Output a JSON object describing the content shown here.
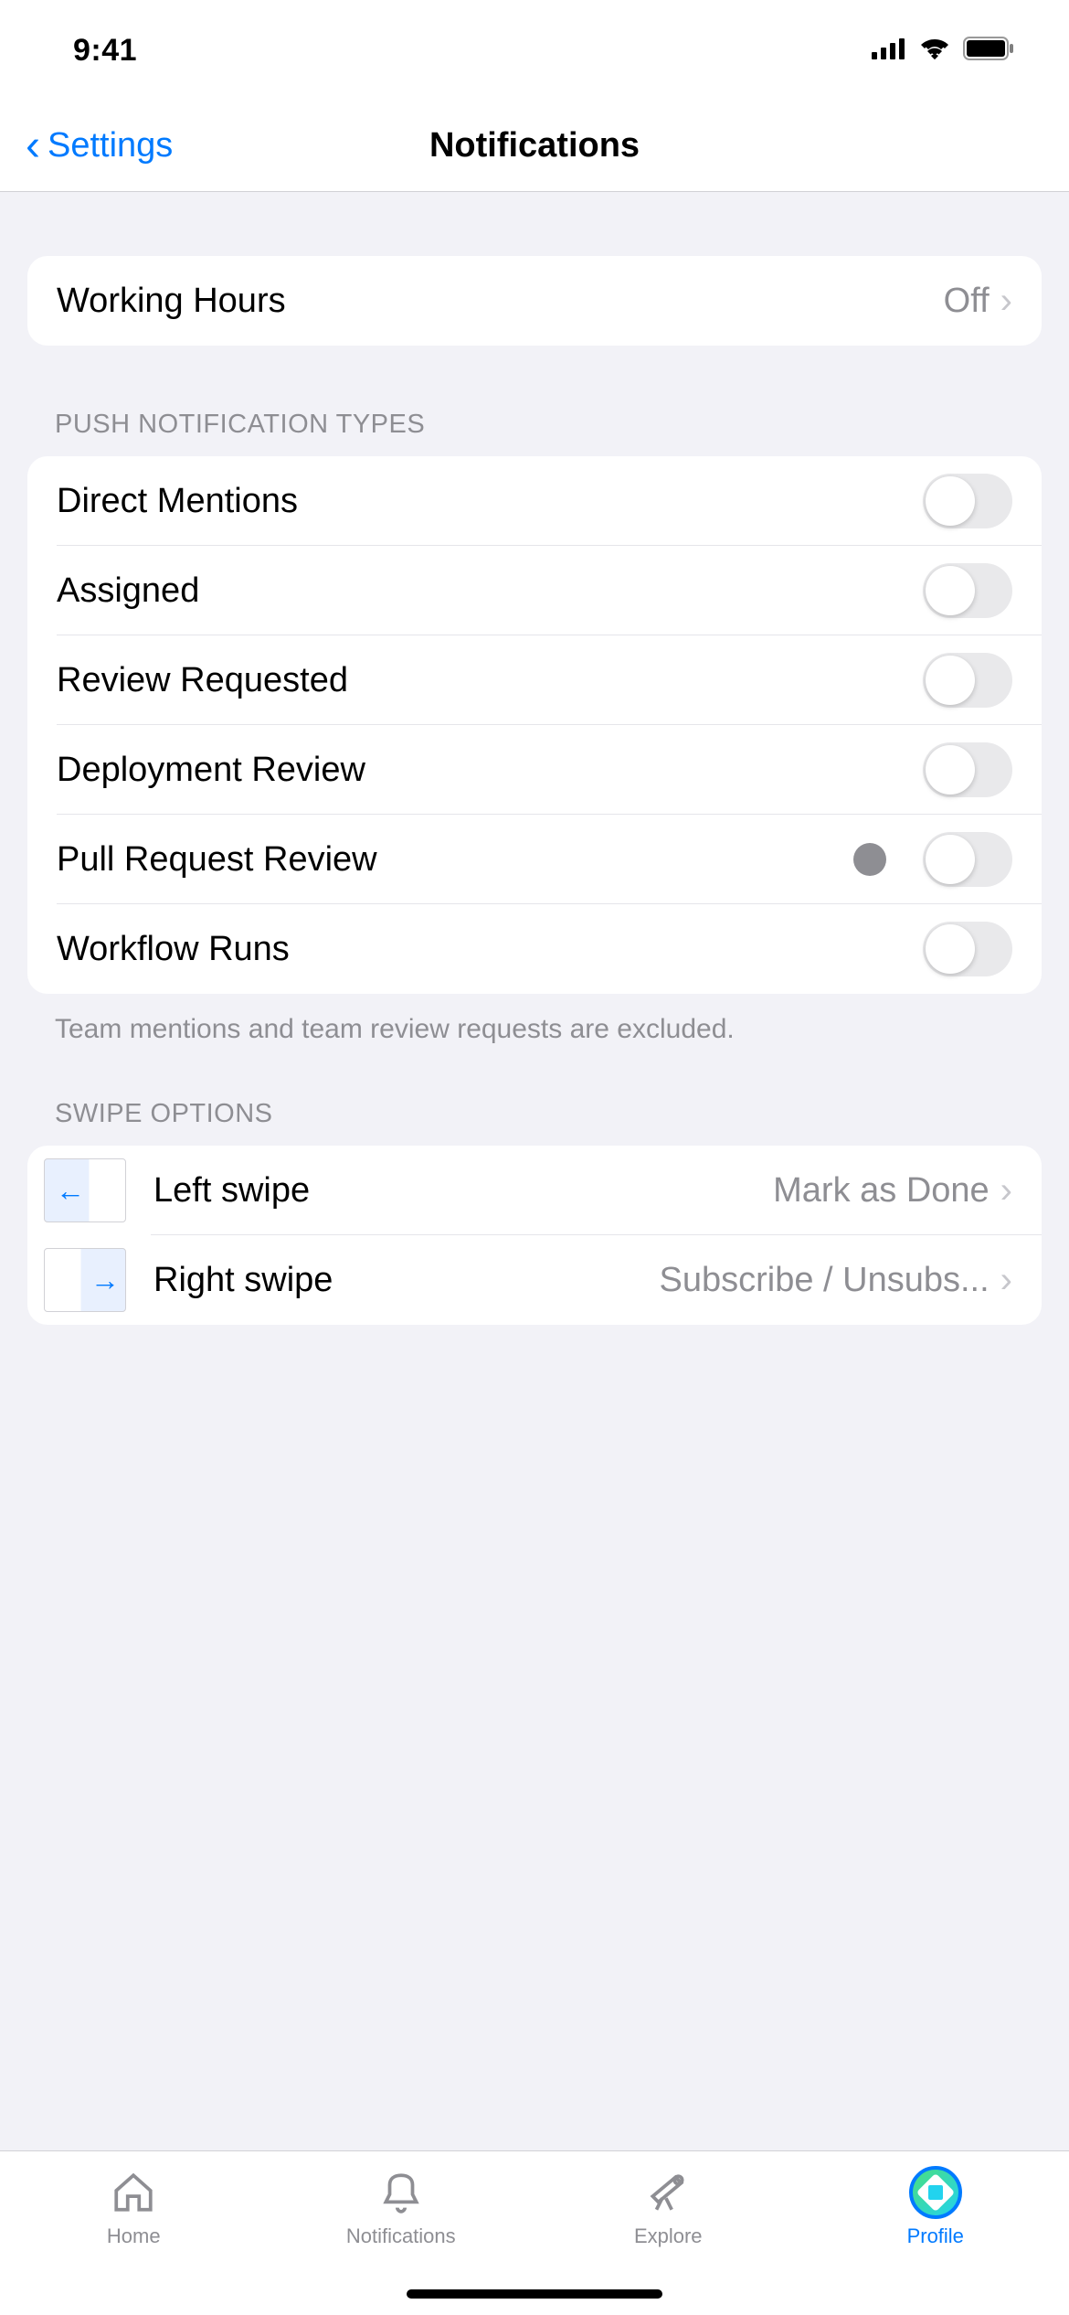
{
  "status": {
    "time": "9:41"
  },
  "nav": {
    "back_label": "Settings",
    "title": "Notifications"
  },
  "working_hours": {
    "label": "Working Hours",
    "value": "Off"
  },
  "push_types": {
    "header": "PUSH NOTIFICATION TYPES",
    "items": [
      {
        "label": "Direct Mentions"
      },
      {
        "label": "Assigned"
      },
      {
        "label": "Review Requested"
      },
      {
        "label": "Deployment Review"
      },
      {
        "label": "Pull Request Review"
      },
      {
        "label": "Workflow Runs"
      }
    ],
    "footer": "Team mentions and team review requests are excluded."
  },
  "swipe_options": {
    "header": "SWIPE OPTIONS",
    "left": {
      "label": "Left swipe",
      "value": "Mark as Done"
    },
    "right": {
      "label": "Right swipe",
      "value": "Subscribe / Unsubs..."
    }
  },
  "tabs": {
    "home": "Home",
    "notifications": "Notifications",
    "explore": "Explore",
    "profile": "Profile"
  }
}
